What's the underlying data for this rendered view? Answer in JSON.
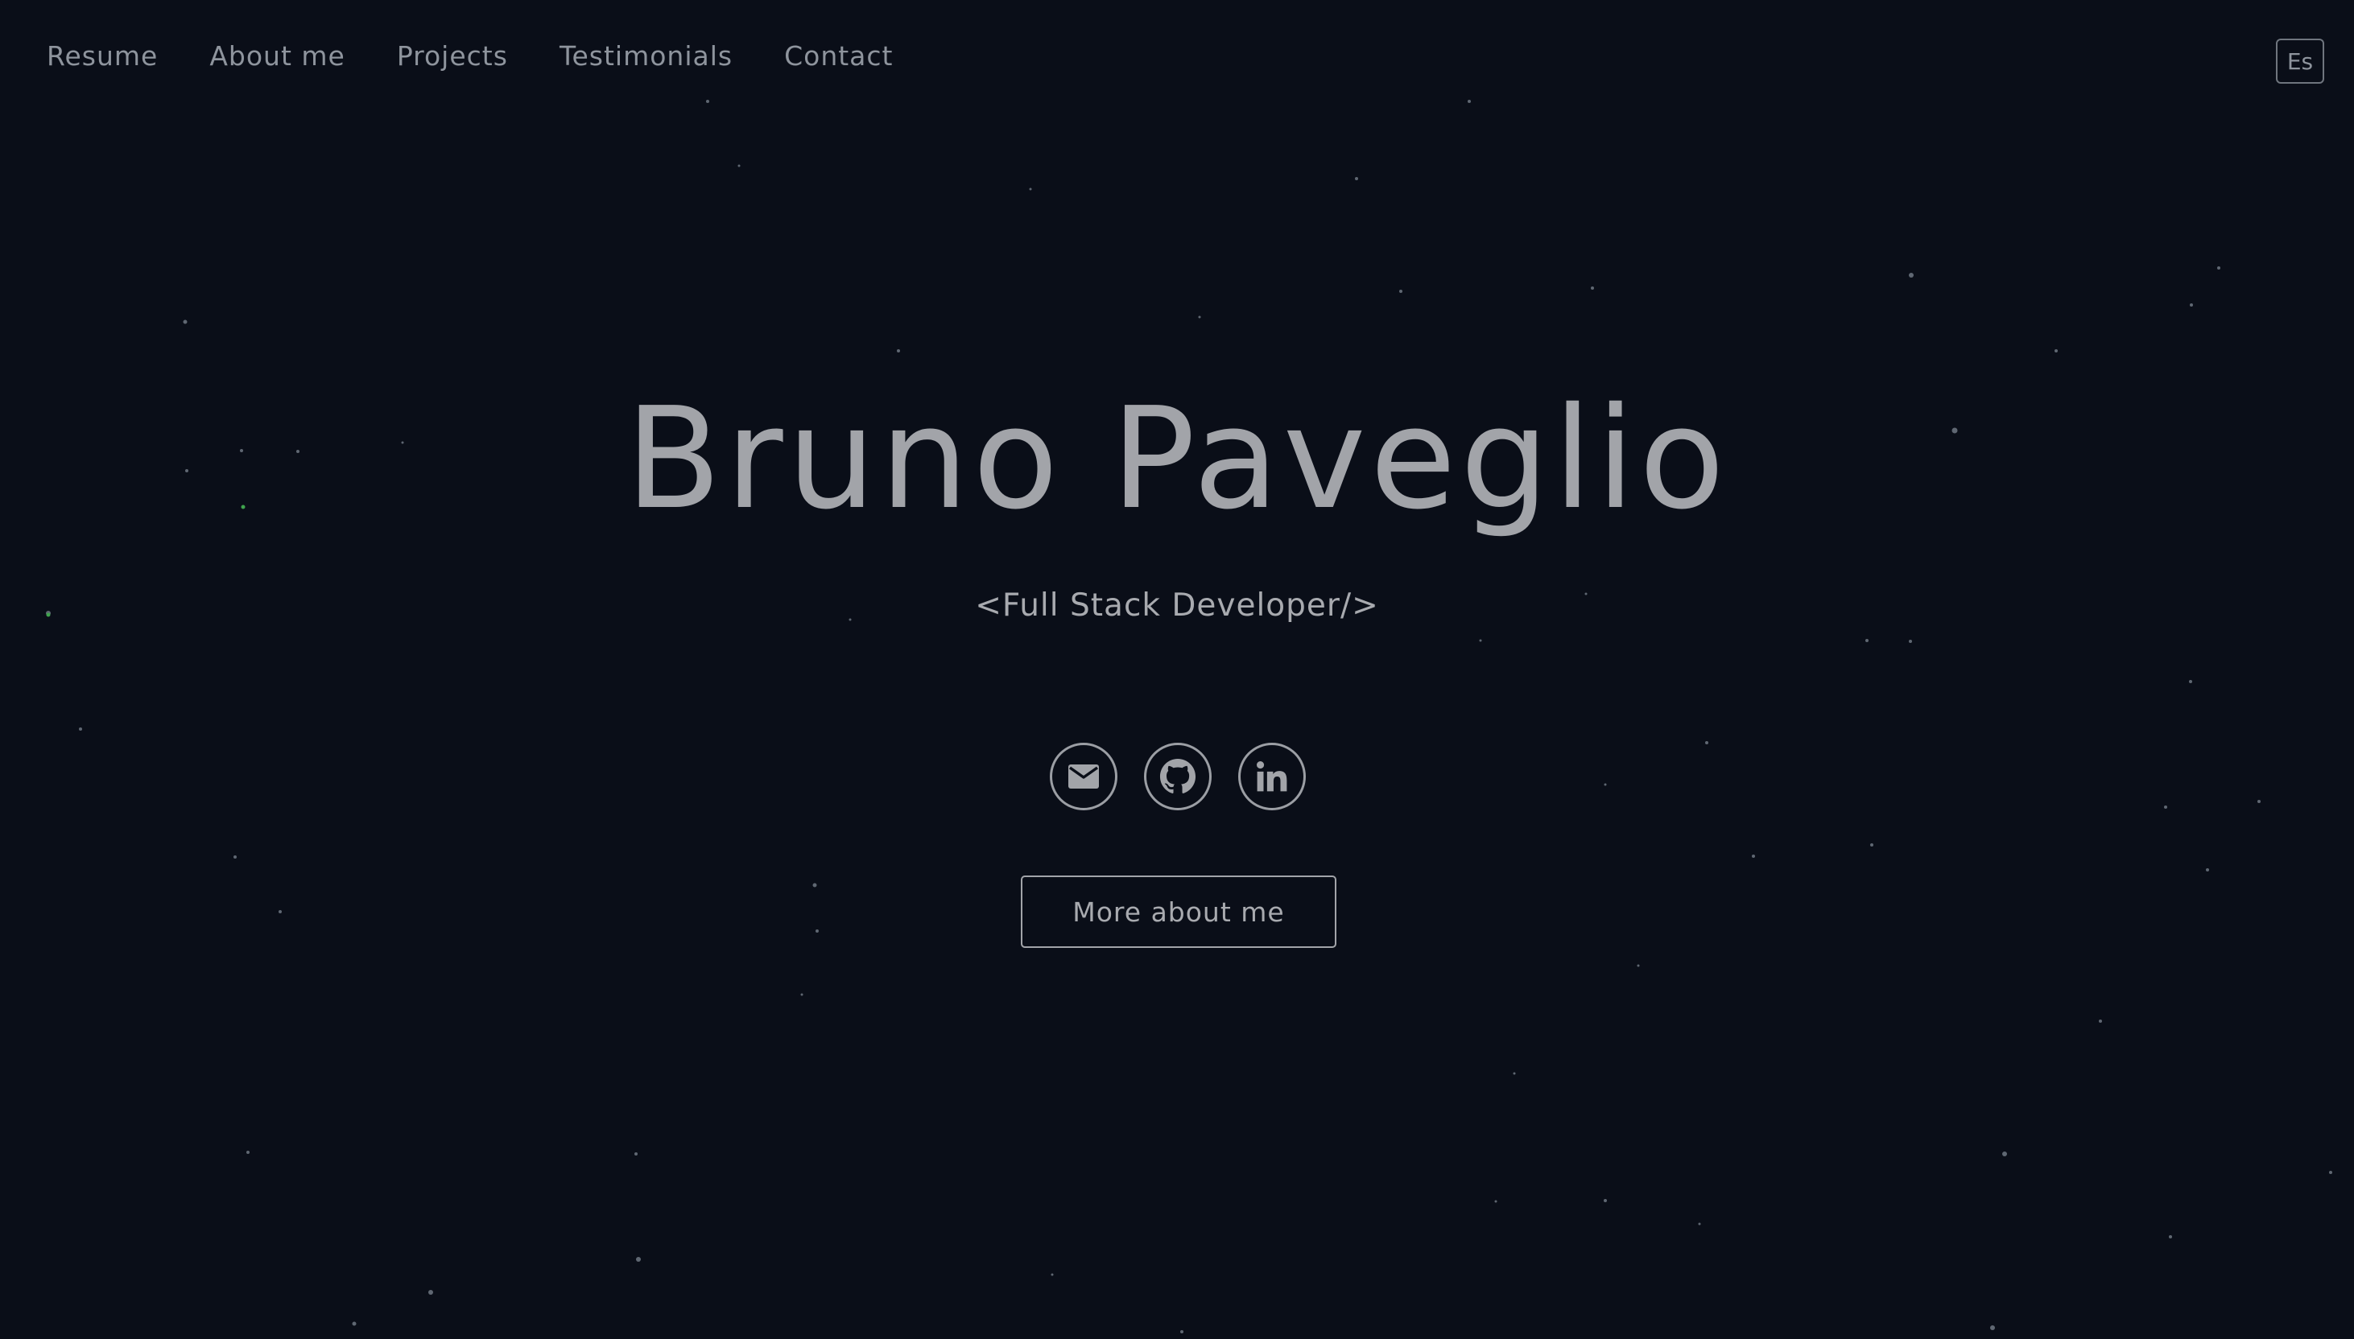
{
  "nav": {
    "items": [
      {
        "label": "Resume"
      },
      {
        "label": "About me"
      },
      {
        "label": "Projects"
      },
      {
        "label": "Testimonials"
      },
      {
        "label": "Contact"
      }
    ],
    "language_toggle": "Es"
  },
  "hero": {
    "name": "Bruno Paveglio",
    "role": "<Full Stack Developer/>"
  },
  "socials": [
    {
      "icon": "mail-icon"
    },
    {
      "icon": "github-icon"
    },
    {
      "icon": "linkedin-icon"
    }
  ],
  "cta": {
    "label": "More about me"
  },
  "colors": {
    "background": "#0a0e18",
    "text": "#a2a4a9",
    "nav_text": "#8e949d",
    "star": "#7c8590",
    "star_accent": "#3fa34d"
  }
}
